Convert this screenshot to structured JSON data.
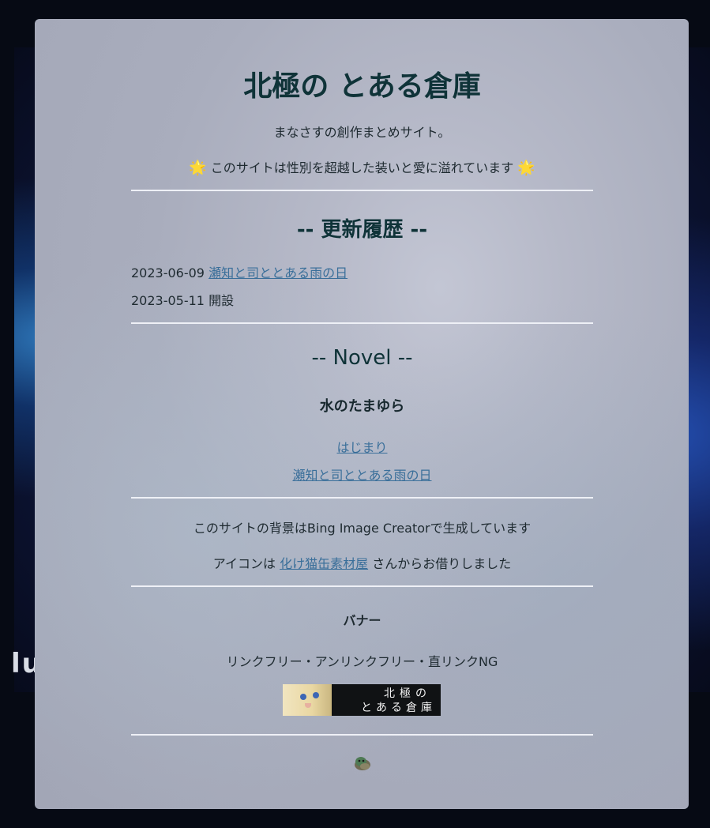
{
  "header": {
    "title": "北極の とある倉庫",
    "tagline": "まなさすの創作まとめサイト。",
    "notice": "このサイトは性別を超越した装いと愛に溢れています",
    "sun_glyph": "🌟"
  },
  "updates": {
    "heading": "-- 更新履歴 --",
    "items": [
      {
        "date": "2023-06-09",
        "text": "瀬知と司ととある雨の日",
        "link": true
      },
      {
        "date": "2023-05-11",
        "text": "開設",
        "link": false
      }
    ]
  },
  "novel": {
    "heading": "-- Novel --",
    "series_title": "水のたまゆら",
    "links": [
      "はじまり",
      "瀬知と司ととある雨の日"
    ]
  },
  "credits": {
    "background_note": "このサイトの背景はBing Image Creatorで生成しています",
    "icon_prefix": "アイコンは",
    "icon_link": "化け猫缶素材屋",
    "icon_suffix": "さんからお借りしました"
  },
  "banner_section": {
    "heading": "バナー",
    "policy": "リンクフリー・アンリンクフリー・直リンクNG",
    "banner_text_line1": "北極の",
    "banner_text_line2": "とある倉庫"
  },
  "background": {
    "glyph_text": "lu"
  },
  "colors": {
    "page_bg": "#060a14",
    "title": "#0f3338",
    "link": "#3a6f9a",
    "divider": "#eef0f6"
  }
}
